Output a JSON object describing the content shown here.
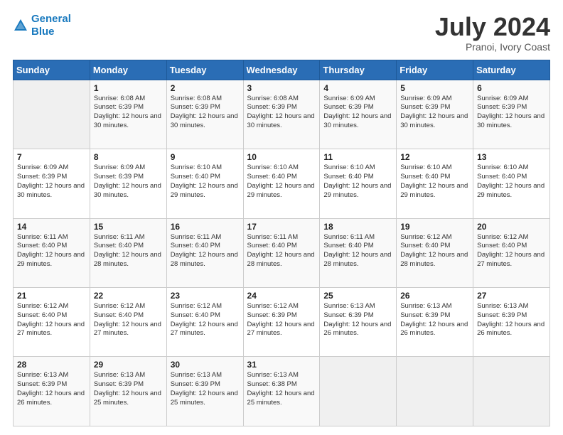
{
  "header": {
    "logo_line1": "General",
    "logo_line2": "Blue",
    "month": "July 2024",
    "location": "Pranoi, Ivory Coast"
  },
  "weekdays": [
    "Sunday",
    "Monday",
    "Tuesday",
    "Wednesday",
    "Thursday",
    "Friday",
    "Saturday"
  ],
  "weeks": [
    [
      {
        "day": "",
        "sunrise": "",
        "sunset": "",
        "daylight": ""
      },
      {
        "day": "1",
        "sunrise": "6:08 AM",
        "sunset": "6:39 PM",
        "daylight": "12 hours and 30 minutes."
      },
      {
        "day": "2",
        "sunrise": "6:08 AM",
        "sunset": "6:39 PM",
        "daylight": "12 hours and 30 minutes."
      },
      {
        "day": "3",
        "sunrise": "6:08 AM",
        "sunset": "6:39 PM",
        "daylight": "12 hours and 30 minutes."
      },
      {
        "day": "4",
        "sunrise": "6:09 AM",
        "sunset": "6:39 PM",
        "daylight": "12 hours and 30 minutes."
      },
      {
        "day": "5",
        "sunrise": "6:09 AM",
        "sunset": "6:39 PM",
        "daylight": "12 hours and 30 minutes."
      },
      {
        "day": "6",
        "sunrise": "6:09 AM",
        "sunset": "6:39 PM",
        "daylight": "12 hours and 30 minutes."
      }
    ],
    [
      {
        "day": "7",
        "sunrise": "6:09 AM",
        "sunset": "6:39 PM",
        "daylight": "12 hours and 30 minutes."
      },
      {
        "day": "8",
        "sunrise": "6:09 AM",
        "sunset": "6:39 PM",
        "daylight": "12 hours and 30 minutes."
      },
      {
        "day": "9",
        "sunrise": "6:10 AM",
        "sunset": "6:40 PM",
        "daylight": "12 hours and 29 minutes."
      },
      {
        "day": "10",
        "sunrise": "6:10 AM",
        "sunset": "6:40 PM",
        "daylight": "12 hours and 29 minutes."
      },
      {
        "day": "11",
        "sunrise": "6:10 AM",
        "sunset": "6:40 PM",
        "daylight": "12 hours and 29 minutes."
      },
      {
        "day": "12",
        "sunrise": "6:10 AM",
        "sunset": "6:40 PM",
        "daylight": "12 hours and 29 minutes."
      },
      {
        "day": "13",
        "sunrise": "6:10 AM",
        "sunset": "6:40 PM",
        "daylight": "12 hours and 29 minutes."
      }
    ],
    [
      {
        "day": "14",
        "sunrise": "6:11 AM",
        "sunset": "6:40 PM",
        "daylight": "12 hours and 29 minutes."
      },
      {
        "day": "15",
        "sunrise": "6:11 AM",
        "sunset": "6:40 PM",
        "daylight": "12 hours and 28 minutes."
      },
      {
        "day": "16",
        "sunrise": "6:11 AM",
        "sunset": "6:40 PM",
        "daylight": "12 hours and 28 minutes."
      },
      {
        "day": "17",
        "sunrise": "6:11 AM",
        "sunset": "6:40 PM",
        "daylight": "12 hours and 28 minutes."
      },
      {
        "day": "18",
        "sunrise": "6:11 AM",
        "sunset": "6:40 PM",
        "daylight": "12 hours and 28 minutes."
      },
      {
        "day": "19",
        "sunrise": "6:12 AM",
        "sunset": "6:40 PM",
        "daylight": "12 hours and 28 minutes."
      },
      {
        "day": "20",
        "sunrise": "6:12 AM",
        "sunset": "6:40 PM",
        "daylight": "12 hours and 27 minutes."
      }
    ],
    [
      {
        "day": "21",
        "sunrise": "6:12 AM",
        "sunset": "6:40 PM",
        "daylight": "12 hours and 27 minutes."
      },
      {
        "day": "22",
        "sunrise": "6:12 AM",
        "sunset": "6:40 PM",
        "daylight": "12 hours and 27 minutes."
      },
      {
        "day": "23",
        "sunrise": "6:12 AM",
        "sunset": "6:40 PM",
        "daylight": "12 hours and 27 minutes."
      },
      {
        "day": "24",
        "sunrise": "6:12 AM",
        "sunset": "6:39 PM",
        "daylight": "12 hours and 27 minutes."
      },
      {
        "day": "25",
        "sunrise": "6:13 AM",
        "sunset": "6:39 PM",
        "daylight": "12 hours and 26 minutes."
      },
      {
        "day": "26",
        "sunrise": "6:13 AM",
        "sunset": "6:39 PM",
        "daylight": "12 hours and 26 minutes."
      },
      {
        "day": "27",
        "sunrise": "6:13 AM",
        "sunset": "6:39 PM",
        "daylight": "12 hours and 26 minutes."
      }
    ],
    [
      {
        "day": "28",
        "sunrise": "6:13 AM",
        "sunset": "6:39 PM",
        "daylight": "12 hours and 26 minutes."
      },
      {
        "day": "29",
        "sunrise": "6:13 AM",
        "sunset": "6:39 PM",
        "daylight": "12 hours and 25 minutes."
      },
      {
        "day": "30",
        "sunrise": "6:13 AM",
        "sunset": "6:39 PM",
        "daylight": "12 hours and 25 minutes."
      },
      {
        "day": "31",
        "sunrise": "6:13 AM",
        "sunset": "6:38 PM",
        "daylight": "12 hours and 25 minutes."
      },
      {
        "day": "",
        "sunrise": "",
        "sunset": "",
        "daylight": ""
      },
      {
        "day": "",
        "sunrise": "",
        "sunset": "",
        "daylight": ""
      },
      {
        "day": "",
        "sunrise": "",
        "sunset": "",
        "daylight": ""
      }
    ]
  ]
}
